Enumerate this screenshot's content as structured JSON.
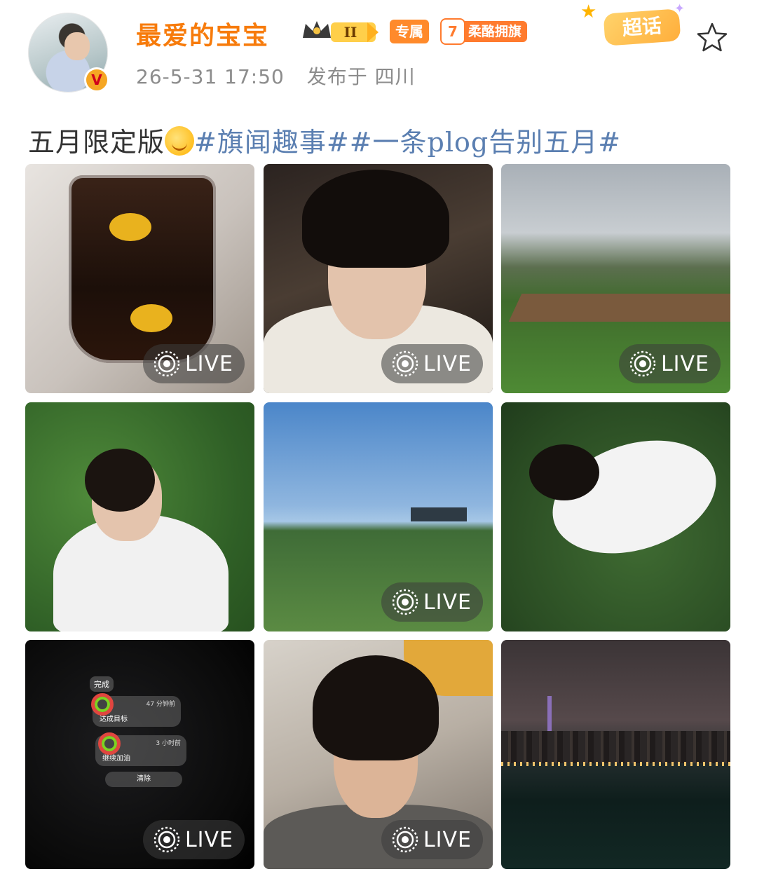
{
  "user": {
    "name": "最爱的宝宝",
    "level_badge": "II",
    "exclusive_badge": "专属",
    "fan_level": "7",
    "fan_group": "柔酪拥旗",
    "supertopic": "超话"
  },
  "meta": {
    "timestamp": "26-5-31 17:50",
    "location": "发布于 四川"
  },
  "post": {
    "text_before": "五月限定版",
    "hashtags": "#旗闻趣事##一条plog告别五月#"
  },
  "photos": [
    {
      "subject": "iced cola drink",
      "live_label": "LIVE"
    },
    {
      "subject": "portrait selfie",
      "live_label": "LIVE"
    },
    {
      "subject": "mountain meadow",
      "live_label": "LIVE"
    },
    {
      "subject": "lying on grass",
      "live_label": ""
    },
    {
      "subject": "kites over field",
      "live_label": "LIVE"
    },
    {
      "subject": "sleeping on grass",
      "live_label": ""
    },
    {
      "subject": "watch notifications",
      "live_label": "LIVE"
    },
    {
      "subject": "portrait in hoodie",
      "live_label": "LIVE"
    },
    {
      "subject": "city skyline at night",
      "live_label": ""
    }
  ],
  "watch_screen": {
    "done": "完成",
    "item1_time": "47 分钟前",
    "item1_text": "达成目标",
    "item2_time": "3 小时前",
    "item2_text": "继续加油",
    "clear": "清除"
  },
  "colors": {
    "username": "#f77b0b",
    "hashtag": "#5b7fb1",
    "meta": "#8c8c8c"
  }
}
